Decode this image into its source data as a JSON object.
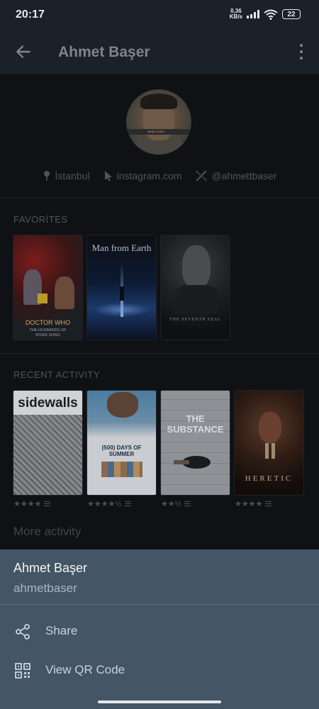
{
  "status_bar": {
    "time": "20:17",
    "speed_value": "0,36",
    "speed_unit": "KB/s",
    "battery": "22"
  },
  "app_bar": {
    "title": "Ahmet Başer",
    "back_icon": "arrow-left-icon",
    "more_icon": "more-vertical-icon"
  },
  "profile": {
    "avatar_icon": "profile-photo",
    "avatar_shirt_text": "WHAT A DEV",
    "location": "İstanbul",
    "website": "instagram.com",
    "twitter": "@ahmettbaser"
  },
  "favorites": {
    "label": "FAVORİTES",
    "items": [
      {
        "title": "DOCTOR WHO",
        "subtitle": "THE HUSBANDS OF RIVER SONG"
      },
      {
        "title": "Man from Earth",
        "subtitle": ""
      },
      {
        "title": "THE SEVENTH SEAL",
        "subtitle": ""
      }
    ]
  },
  "recent_activity": {
    "label": "RECENT ACTIVITY",
    "items": [
      {
        "title": "sidewalls",
        "rating": "★★★★"
      },
      {
        "title": "(500) DAYS OF SUMMER",
        "rating": "★★★★½"
      },
      {
        "title": "THE SUBSTANCE",
        "rating": "★★½"
      },
      {
        "title": "HERETIC",
        "rating": "★★★★"
      }
    ],
    "more_label": "More activity"
  },
  "sheet": {
    "name": "Ahmet Başer",
    "username": "ahmetbaser",
    "share_label": "Share",
    "qr_label": "View QR Code"
  },
  "colors": {
    "background": "#0f1114",
    "bar": "#1b2128",
    "sheet": "#445565"
  }
}
